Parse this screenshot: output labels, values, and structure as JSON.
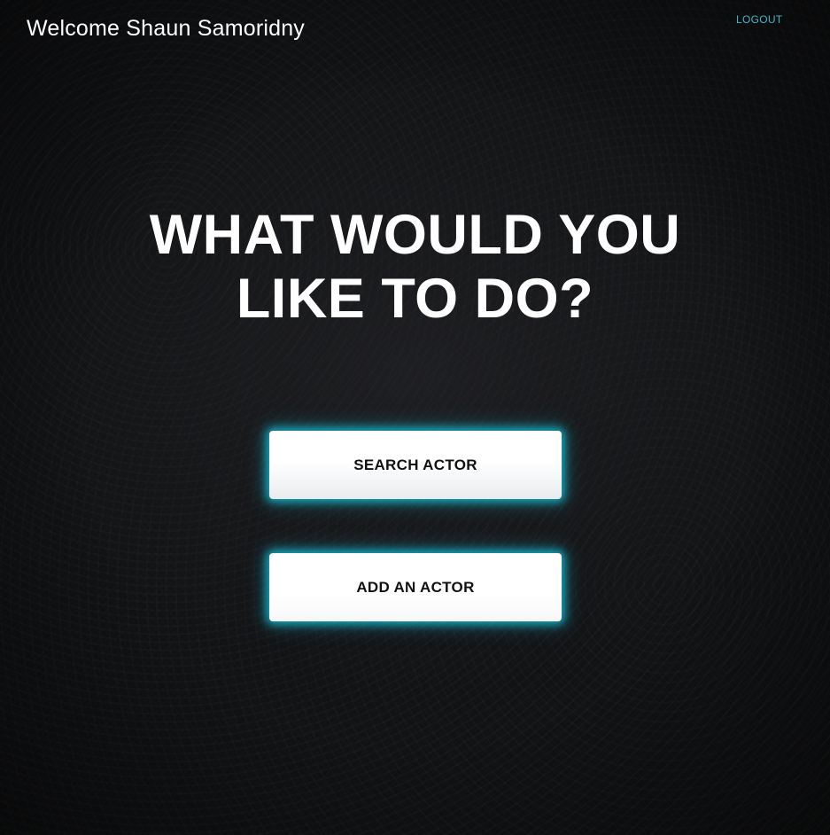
{
  "header": {
    "welcome_text": "Welcome Shaun Samoridny",
    "logout_label": "LOGOUT"
  },
  "main": {
    "headline_line1": "WHAT WOULD YOU",
    "headline_line2": "LIKE TO DO?",
    "actions": [
      {
        "label": "SEARCH ACTOR"
      },
      {
        "label": "ADD AN ACTOR"
      }
    ]
  },
  "colors": {
    "background": "#111214",
    "logout_link": "#3fb8c6",
    "button_glow": "#16d2eb",
    "button_text": "#111111",
    "headline": "#ffffff"
  }
}
